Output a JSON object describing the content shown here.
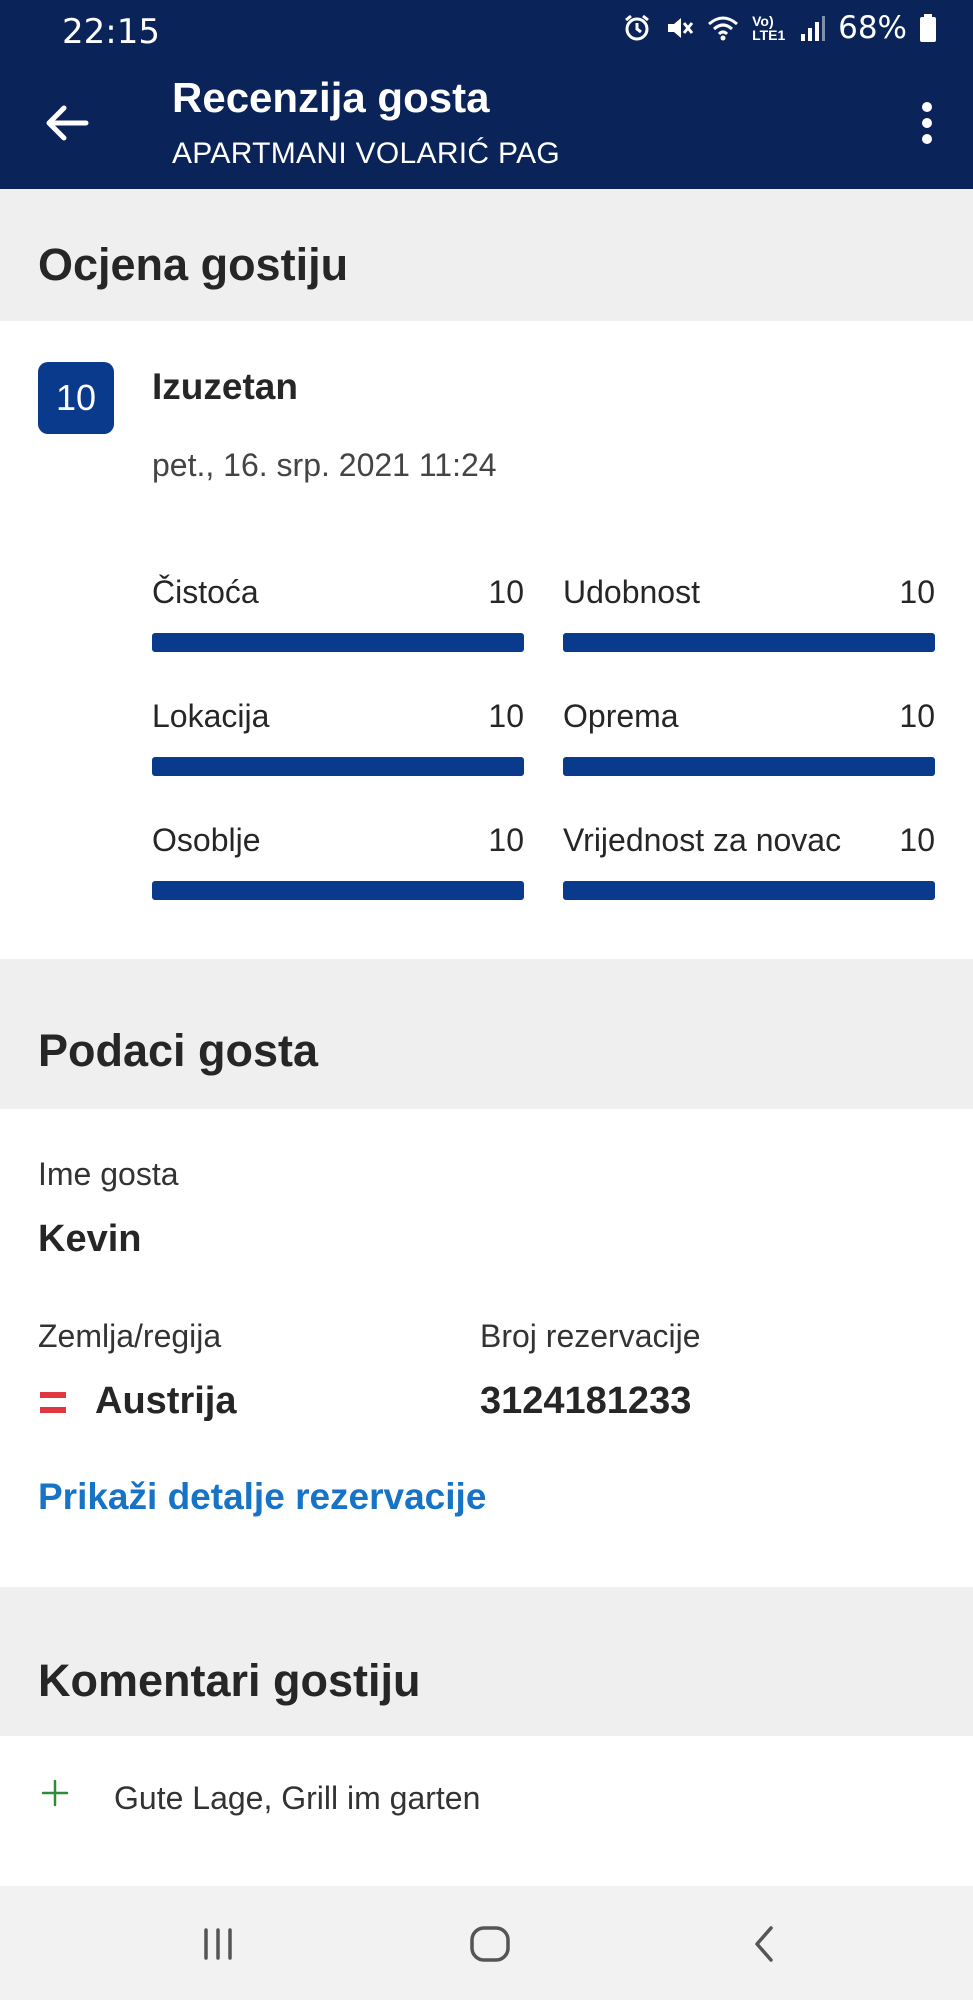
{
  "status_bar": {
    "time": "22:15",
    "battery": "68%",
    "network": "Vo) LTE1"
  },
  "header": {
    "title": "Recenzija gosta",
    "subtitle": "APARTMANI VOLARIĆ PAG"
  },
  "rating_section": {
    "heading": "Ocjena gostiju",
    "score": "10",
    "score_label": "Izuzetan",
    "date": "pet., 16. srp. 2021 11:24",
    "categories": [
      {
        "name": "Čistoća",
        "value": "10",
        "fraction": 1.0
      },
      {
        "name": "Udobnost",
        "value": "10",
        "fraction": 1.0
      },
      {
        "name": "Lokacija",
        "value": "10",
        "fraction": 1.0
      },
      {
        "name": "Oprema",
        "value": "10",
        "fraction": 1.0
      },
      {
        "name": "Osoblje",
        "value": "10",
        "fraction": 1.0
      },
      {
        "name": "Vrijednost za novac",
        "value": "10",
        "fraction": 1.0
      }
    ]
  },
  "guest_section": {
    "heading": "Podaci gosta",
    "name_label": "Ime gosta",
    "name_value": "Kevin",
    "country_label": "Zemlja/regija",
    "country_value": "Austrija",
    "booking_label": "Broj rezervacije",
    "booking_value": "3124181233",
    "details_link": "Prikaži detalje rezervacije"
  },
  "comments_section": {
    "heading": "Komentari gostiju",
    "positive_comment": "Gute Lage, Grill im garten"
  },
  "icons": {
    "back": "arrow-left-icon",
    "more": "more-vertical-icon",
    "flag": "austria-flag-icon",
    "plus": "plus-icon",
    "nav_recents": "recents-icon",
    "nav_home": "home-icon",
    "nav_back": "chevron-left-icon"
  },
  "colors": {
    "header_bg": "#0a2358",
    "accent": "#0a3a8c",
    "link": "#1673c5",
    "positive": "#2e8b3a",
    "flag_red": "#e0383e"
  }
}
